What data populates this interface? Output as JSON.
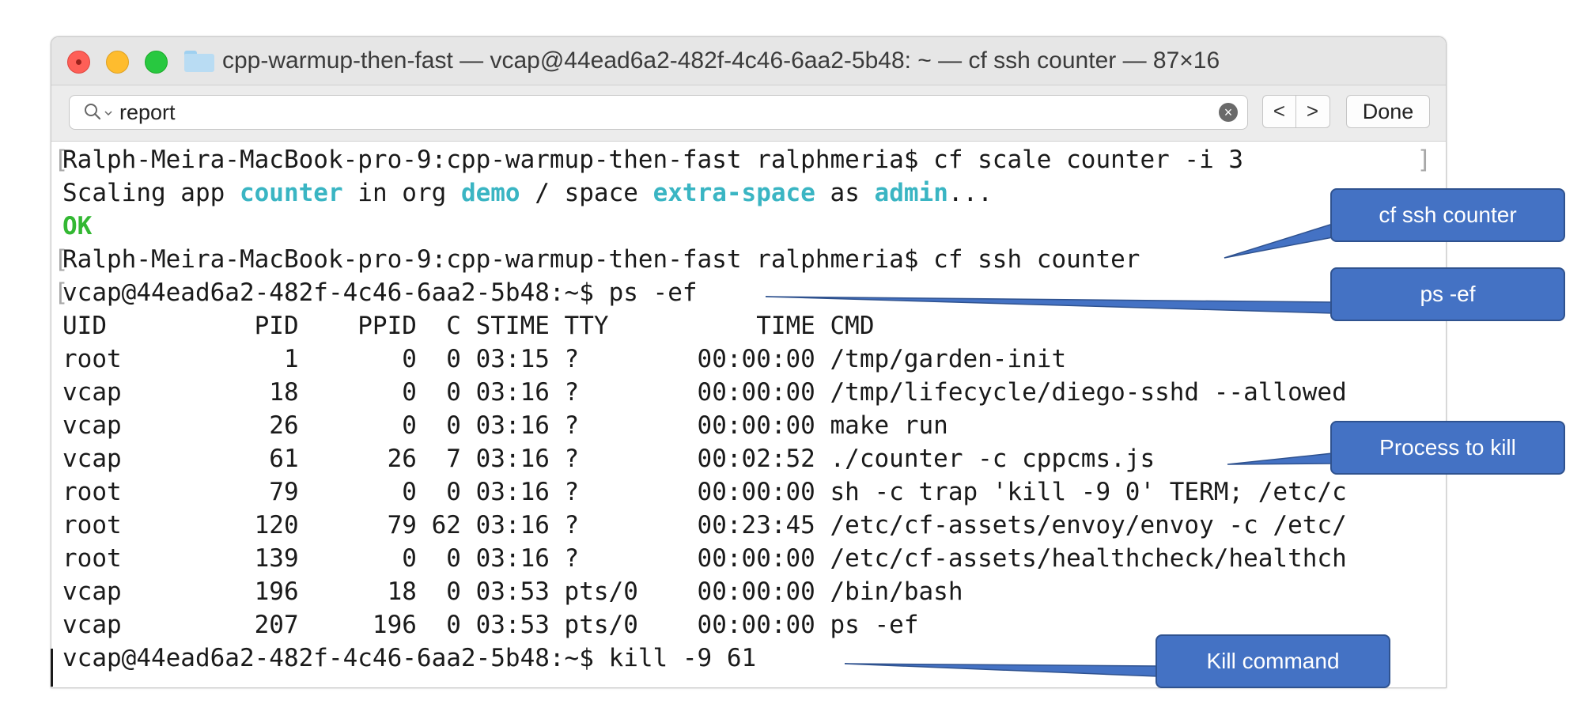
{
  "window": {
    "title": "cpp-warmup-then-fast — vcap@44ead6a2-482f-4c46-6aa2-5b48: ~ — cf ssh counter — 87×16"
  },
  "findbar": {
    "search_value": "report",
    "prev_label": "<",
    "next_label": ">",
    "done_label": "Done"
  },
  "terminal": {
    "cmd1": {
      "prompt": "Ralph-Meira-MacBook-pro-9:cpp-warmup-then-fast ralphmeria$ ",
      "command": "cf scale counter -i 3"
    },
    "scaling": {
      "p1": "Scaling app ",
      "app": "counter",
      "p2": " in org ",
      "org": "demo",
      "p3": " / space ",
      "space": "extra-space",
      "p4": " as ",
      "user": "admin",
      "p5": "..."
    },
    "ok": "OK",
    "cmd2": {
      "prompt": "Ralph-Meira-MacBook-pro-9:cpp-warmup-then-fast ralphmeria$ ",
      "command": "cf ssh counter"
    },
    "cmd3": {
      "prompt": "vcap@44ead6a2-482f-4c46-6aa2-5b48:~$ ",
      "command": "ps -ef"
    },
    "ps_header": "UID          PID    PPID  C STIME TTY          TIME CMD",
    "ps_rows": [
      "root           1       0  0 03:15 ?        00:00:00 /tmp/garden-init",
      "vcap          18       0  0 03:16 ?        00:00:00 /tmp/lifecycle/diego-sshd --allowed",
      "vcap          26       0  0 03:16 ?        00:00:00 make run",
      "vcap          61      26  7 03:16 ?        00:02:52 ./counter -c cppcms.js",
      "root          79       0  0 03:16 ?        00:00:00 sh -c trap 'kill -9 0' TERM; /etc/c",
      "root         120      79 62 03:16 ?        00:23:45 /etc/cf-assets/envoy/envoy -c /etc/",
      "root         139       0  0 03:16 ?        00:00:00 /etc/cf-assets/healthcheck/healthch",
      "vcap         196      18  0 03:53 pts/0    00:00:00 /bin/bash",
      "vcap         207     196  0 03:53 pts/0    00:00:00 ps -ef"
    ],
    "cmd4": {
      "prompt": "vcap@44ead6a2-482f-4c46-6aa2-5b48:~$ ",
      "command": "kill -9 61"
    },
    "bracket_open": "[",
    "bracket_close": "]"
  },
  "callouts": {
    "ssh": "cf ssh counter",
    "ps": "ps -ef",
    "process": "Process to kill",
    "kill": "Kill command"
  },
  "colors": {
    "highlight": "#3ab5c3",
    "ok": "#33b833",
    "callout_fill": "#4472c4",
    "close": "#fe5f57",
    "minimize": "#febc2e",
    "zoom": "#28c840"
  }
}
